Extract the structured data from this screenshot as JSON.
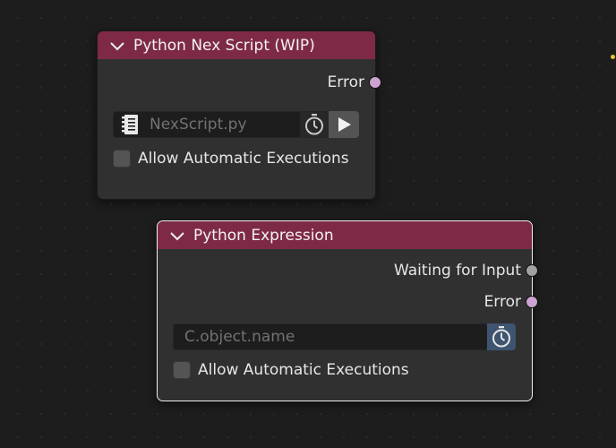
{
  "nodes": {
    "nex_script": {
      "title": "Python Nex Script (WIP)",
      "outputs": {
        "error_label": "Error"
      },
      "script_field": {
        "value": "NexScript.py"
      },
      "checkbox_label": "Allow Automatic Executions"
    },
    "expression": {
      "title": "Python Expression",
      "outputs": {
        "waiting_label": "Waiting for Input",
        "error_label": "Error"
      },
      "expression_field": {
        "placeholder": "C.object.name"
      },
      "checkbox_label": "Allow Automatic Executions"
    }
  },
  "colors": {
    "header": "#7e2a46",
    "socket_error": "#cca3d2",
    "socket_waiting": "#a1a1a1",
    "timer_active": "#3e5470"
  },
  "icons": [
    "chevron-down-icon",
    "script-file-icon",
    "stopwatch-icon",
    "play-icon"
  ]
}
